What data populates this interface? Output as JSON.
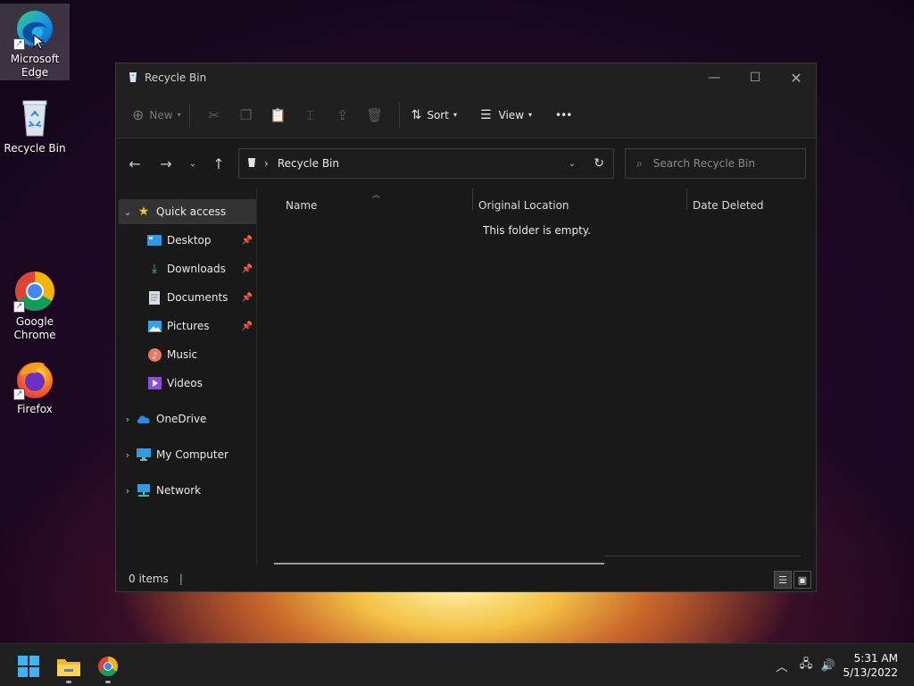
{
  "desktop": {
    "icons": [
      {
        "label_1": "Microsoft",
        "label_2": "Edge"
      },
      {
        "label_1": "Recycle Bin"
      },
      {
        "label_1": "Google",
        "label_2": "Chrome"
      },
      {
        "label_1": "Firefox"
      }
    ]
  },
  "window": {
    "title": "Recycle Bin",
    "toolbar": {
      "new_label": "New",
      "sort_label": "Sort",
      "view_label": "View",
      "more_label": "•••"
    },
    "address": {
      "location": "Recycle Bin"
    },
    "search": {
      "placeholder": "Search Recycle Bin"
    },
    "sidebar": {
      "quick_access": "Quick access",
      "items": [
        "Desktop",
        "Downloads",
        "Documents",
        "Pictures",
        "Music",
        "Videos"
      ],
      "onedrive": "OneDrive",
      "my_computer": "My Computer",
      "network": "Network"
    },
    "columns": [
      "Name",
      "Original Location",
      "Date Deleted"
    ],
    "empty_message": "This folder is empty.",
    "status": {
      "items_count": "0 items"
    }
  },
  "taskbar": {
    "clock": {
      "time": "5:31 AM",
      "date": "5/13/2022"
    }
  },
  "colors": {
    "accent": "#4cc2ff",
    "window_bg": "#191919",
    "taskbar_bg": "#1f1f1f"
  }
}
